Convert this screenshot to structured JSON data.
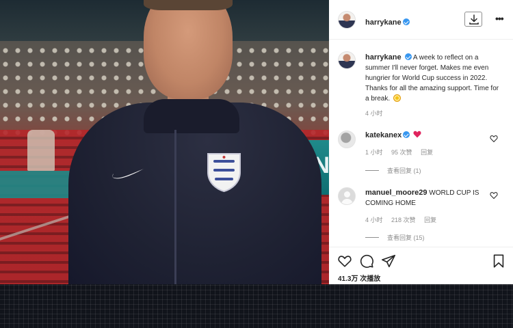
{
  "colors": {
    "accent_verified": "#3897f0",
    "text_primary": "#262626",
    "text_secondary": "#8e8e8e",
    "heart_red": "#ed4956",
    "background_panel": "#ffffff"
  },
  "video": {
    "banner_text": "ON"
  },
  "header": {
    "username": "harrykane",
    "download_icon": "download-icon",
    "more_icon": "more-options-icon",
    "more_label": "•••"
  },
  "caption": {
    "username": "harrykane",
    "text": "A week to reflect on a summer I'll never forget. Makes me even hungrier for World Cup success in 2022. Thanks for all the amazing support. Time for a break.",
    "emoji": "sun-emoji",
    "time": "4 小时"
  },
  "comments": [
    {
      "username": "katekanex",
      "verified": true,
      "text_icon": "red-heart-emoji",
      "time": "1 小时",
      "likes": "95 次赞",
      "reply": "回复",
      "view_replies": "查看回复 (1)"
    },
    {
      "username": "manuel_moore29",
      "verified": false,
      "text": "WORLD CUP IS COMING HOME",
      "time": "4 小时",
      "likes": "218 次赞",
      "reply": "回复",
      "view_replies": "查看回复 (15)"
    }
  ],
  "actions": {
    "like_icon": "heart-outline-icon",
    "comment_icon": "comment-icon",
    "share_icon": "paper-plane-icon",
    "save_icon": "bookmark-icon",
    "views": "41.3万 次播放"
  }
}
